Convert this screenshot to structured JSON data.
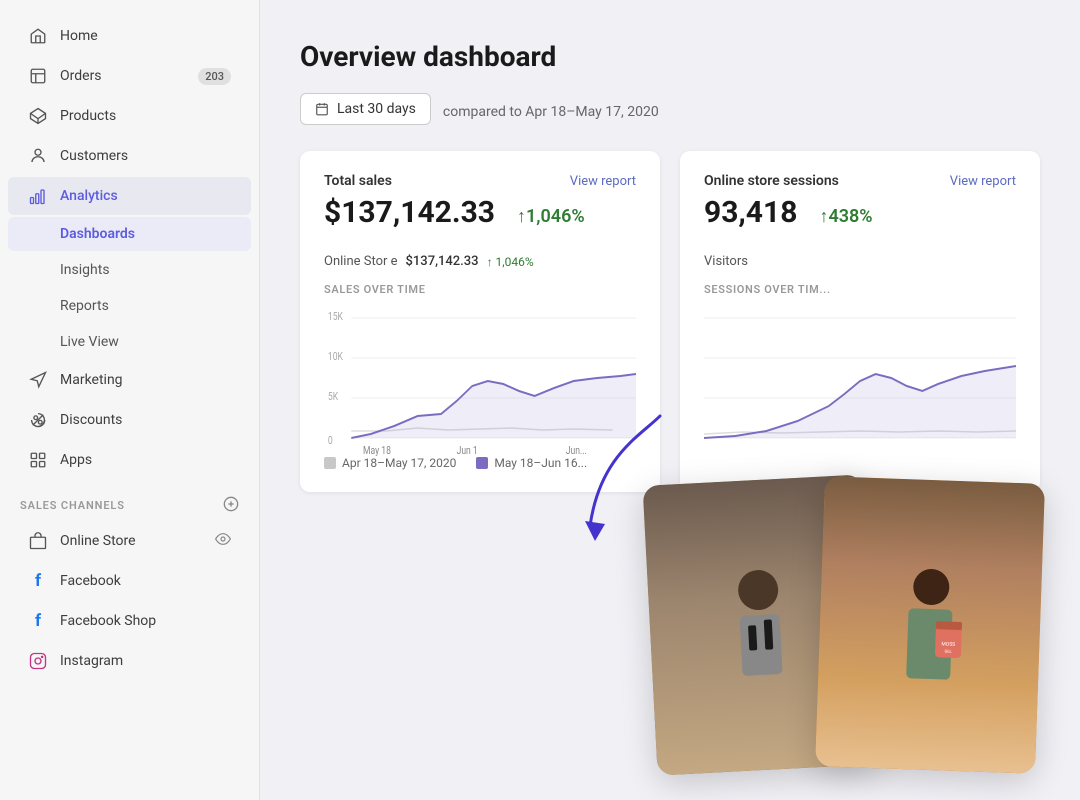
{
  "sidebar": {
    "nav_items": [
      {
        "id": "home",
        "label": "Home",
        "icon": "home",
        "active": false,
        "badge": null
      },
      {
        "id": "orders",
        "label": "Orders",
        "icon": "orders",
        "active": false,
        "badge": "203"
      },
      {
        "id": "products",
        "label": "Products",
        "icon": "products",
        "active": false,
        "badge": null
      },
      {
        "id": "customers",
        "label": "Customers",
        "icon": "customers",
        "active": false,
        "badge": null
      },
      {
        "id": "analytics",
        "label": "Analytics",
        "icon": "analytics",
        "active": true,
        "badge": null
      },
      {
        "id": "dashboards",
        "label": "Dashboards",
        "icon": null,
        "sub": true,
        "active": true,
        "badge": null
      },
      {
        "id": "insights",
        "label": "Insights",
        "icon": null,
        "sub": true,
        "active": false,
        "badge": null
      },
      {
        "id": "reports",
        "label": "Reports",
        "icon": null,
        "sub": true,
        "active": false,
        "badge": null
      },
      {
        "id": "live-view",
        "label": "Live View",
        "icon": null,
        "sub": true,
        "active": false,
        "badge": null
      },
      {
        "id": "marketing",
        "label": "Marketing",
        "icon": "marketing",
        "active": false,
        "badge": null
      },
      {
        "id": "discounts",
        "label": "Discounts",
        "icon": "discounts",
        "active": false,
        "badge": null
      },
      {
        "id": "apps",
        "label": "Apps",
        "icon": "apps",
        "active": false,
        "badge": null
      }
    ],
    "sales_channels_label": "SALES CHANNELS",
    "channels": [
      {
        "id": "online-store",
        "label": "Online Store",
        "icon": "store"
      },
      {
        "id": "facebook",
        "label": "Facebook",
        "icon": "facebook"
      },
      {
        "id": "facebook-shop",
        "label": "Facebook Shop",
        "icon": "facebook"
      },
      {
        "id": "instagram",
        "label": "Instagram",
        "icon": "instagram"
      }
    ]
  },
  "header": {
    "title": "Overview dashboard"
  },
  "filter": {
    "date_range": "Last 30 days",
    "compare_text": "compared to Apr 18–May 17, 2020"
  },
  "cards": {
    "total_sales": {
      "label": "Total sales",
      "view_report": "View report",
      "value": "$137,142.33",
      "change": "↑1,046%",
      "sub_label": "Online Stor e",
      "sub_value": "$137,142.33",
      "sub_change": "↑ 1,046%"
    },
    "online_sessions": {
      "label": "Online store sessions",
      "view_report": "View report",
      "value": "93,418",
      "change": "↑438%",
      "sub_label": "Visitors",
      "sub_value": "",
      "sub_change": ""
    }
  },
  "chart": {
    "label": "SALES OVER TIME",
    "y_labels": [
      "15K",
      "10K",
      "5K",
      "0"
    ],
    "x_labels": [
      "May 18",
      "Jun 1",
      "Jun..."
    ],
    "legend": [
      {
        "label": "Apr 18–May 17, 2020",
        "color": "#c8c8c8"
      },
      {
        "label": "May 18–Jun 16...",
        "color": "#7c6bc0"
      }
    ]
  },
  "sessions_chart": {
    "label": "SESSIONS OVER TIM..."
  }
}
